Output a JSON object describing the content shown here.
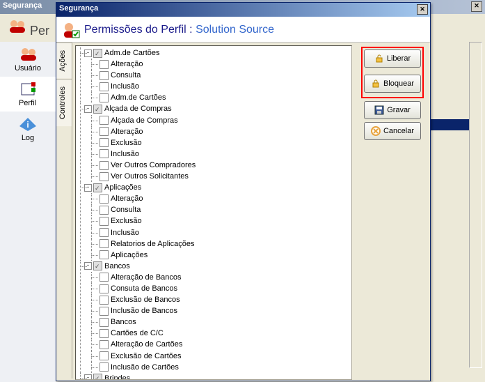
{
  "bg": {
    "title": "Segurança",
    "heading_prefix": "Per"
  },
  "sidebar": {
    "items": [
      {
        "label": "Usuário"
      },
      {
        "label": "Perfil"
      },
      {
        "label": "Log"
      }
    ]
  },
  "dialog": {
    "title": "Segurança",
    "header_prefix": "Permissões do Perfil : ",
    "profile_name": "Solution Source",
    "tabs": {
      "acoes": "Ações",
      "controles": "Controles"
    },
    "buttons": {
      "liberar": "Liberar",
      "bloquear": "Bloquear",
      "gravar": "Gravar",
      "cancelar": "Cancelar"
    },
    "tree": [
      {
        "label": "Adm.de Cartões",
        "state": "tri",
        "expander": "-",
        "children": [
          {
            "label": "Alteração"
          },
          {
            "label": "Consulta"
          },
          {
            "label": "Inclusão"
          },
          {
            "label": "Adm.de Cartões"
          }
        ]
      },
      {
        "label": "Alçada de Compras",
        "state": "tri",
        "expander": "-",
        "children": [
          {
            "label": "Alçada de Compras"
          },
          {
            "label": "Alteração"
          },
          {
            "label": "Exclusão"
          },
          {
            "label": "Inclusão"
          },
          {
            "label": "Ver Outros Compradores"
          },
          {
            "label": "Ver Outros Solicitantes"
          }
        ]
      },
      {
        "label": "Aplicações",
        "state": "tri",
        "expander": "-",
        "children": [
          {
            "label": "Alteração"
          },
          {
            "label": "Consulta"
          },
          {
            "label": "Exclusão"
          },
          {
            "label": "Inclusão"
          },
          {
            "label": "Relatorios de Aplicações"
          },
          {
            "label": "Aplicações"
          }
        ]
      },
      {
        "label": "Bancos",
        "state": "tri",
        "expander": "-",
        "children": [
          {
            "label": "Alteração de Bancos"
          },
          {
            "label": "Consuta de Bancos"
          },
          {
            "label": "Exclusão de Bancos"
          },
          {
            "label": "Inclusão de Bancos"
          },
          {
            "label": "Bancos"
          },
          {
            "label": "Cartões de C/C"
          },
          {
            "label": "Alteração de Cartões"
          },
          {
            "label": "Exclusão de Cartões"
          },
          {
            "label": "Inclusão de Cartões"
          }
        ]
      },
      {
        "label": "Brindes",
        "state": "tri",
        "expander": "-"
      }
    ]
  }
}
